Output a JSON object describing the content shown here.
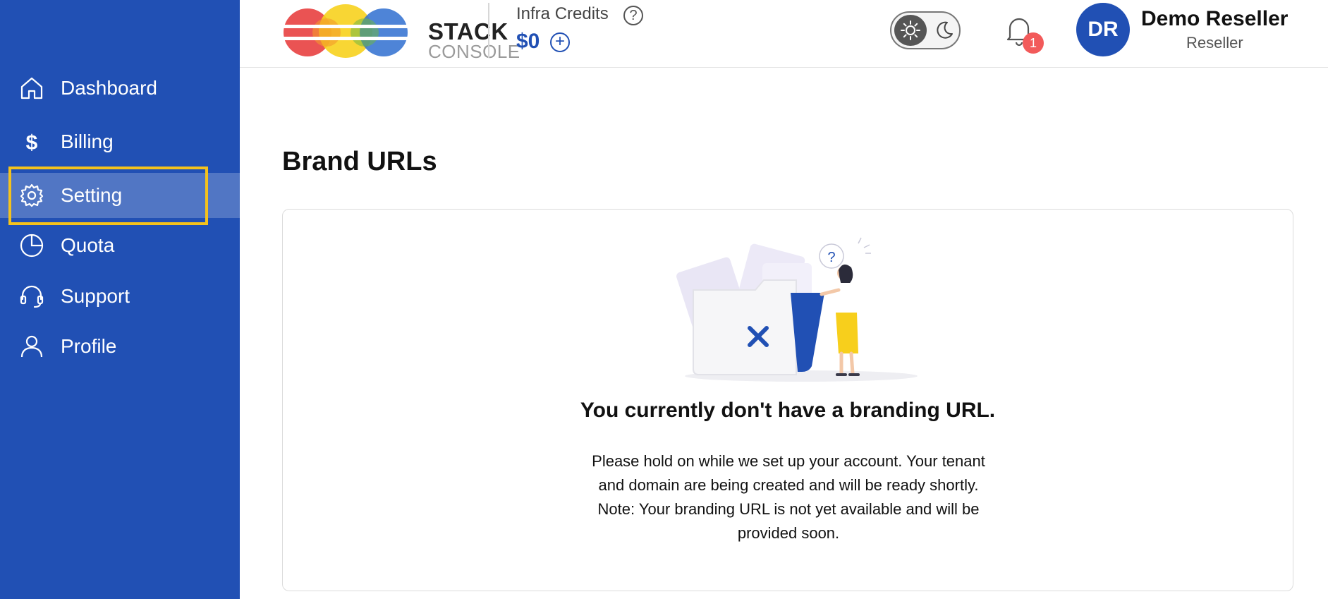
{
  "sidebar": {
    "items": [
      {
        "label": "Dashboard",
        "icon": "home-icon"
      },
      {
        "label": "Billing",
        "icon": "dollar-icon"
      },
      {
        "label": "Setting",
        "icon": "gear-icon",
        "active": true
      },
      {
        "label": "Quota",
        "icon": "pie-chart-icon"
      },
      {
        "label": "Support",
        "icon": "headset-icon"
      },
      {
        "label": "Profile",
        "icon": "user-icon"
      }
    ]
  },
  "header": {
    "logo_line1": "STACK",
    "logo_line2": "CONSOLE",
    "credits_label": "Infra Credits",
    "credits_help": "?",
    "credits_value": "$0",
    "credits_add": "+",
    "notification_count": "1",
    "user_initials": "DR",
    "user_name": "Demo Reseller",
    "user_role": "Reseller"
  },
  "main": {
    "title": "Brand URLs",
    "empty_title": "You currently don't have a branding URL.",
    "empty_lines": [
      "Please hold on while we set up your account. Your tenant",
      "and domain are being created and will be ready shortly.",
      "Note: Your branding URL is not yet available and will be",
      "provided soon."
    ],
    "illustration_question": "?"
  },
  "colors": {
    "primary": "#2150b4",
    "highlight": "#f4c21c",
    "badge": "#f25a5a"
  }
}
